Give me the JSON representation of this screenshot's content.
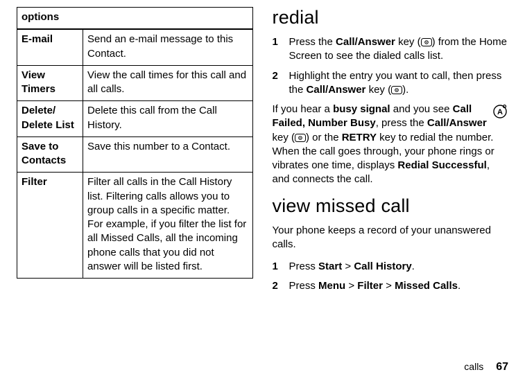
{
  "table": {
    "header": "options",
    "rows": [
      {
        "name": "E-mail",
        "desc": "Send an e-mail message to this Contact."
      },
      {
        "name": "View Timers",
        "desc": "View the call times for this call and all calls."
      },
      {
        "name": "Delete/\nDelete List",
        "desc": "Delete this call from the Call History."
      },
      {
        "name": "Save to Contacts",
        "desc": "Save this number to a Contact."
      },
      {
        "name": "Filter",
        "desc": "Filter all calls in the Call History list. Filtering calls allows you to group calls in a specific matter. For example, if you filter the list for all Missed Calls, all the incoming phone calls that you did not answer will be listed first."
      }
    ]
  },
  "redial": {
    "heading": "redial",
    "step1_num": "1",
    "step1_pre": "Press the ",
    "step1_key": "Call/Answer",
    "step1_mid": " key (",
    "step1_post": ") from the Home Screen to see the dialed calls list.",
    "step2_num": "2",
    "step2_pre": "Highlight the entry you want to call, then press the ",
    "step2_key": "Call/Answer",
    "step2_mid": " key (",
    "step2_post": ").",
    "busy_pre": "If you hear a ",
    "busy_strong": "busy signal",
    "busy_mid1": " and you see ",
    "busy_callfailed": "Call Failed, Number Busy",
    "busy_mid2": ", press the ",
    "busy_key": "Call/Answer",
    "busy_mid3": " key (",
    "busy_mid4": ") or the ",
    "busy_retry": "RETRY",
    "busy_mid5": " key to redial the number. When the call goes through, your phone rings or vibrates one time, displays ",
    "busy_success": "Redial Successful",
    "busy_post": ", and connects the call."
  },
  "missed": {
    "heading": "view missed call",
    "intro": "Your phone keeps a record of your unanswered calls.",
    "step1_num": "1",
    "step1_pre": "Press ",
    "step1_start": "Start",
    "step1_gt": " > ",
    "step1_ch": "Call History",
    "step1_post": ".",
    "step2_num": "2",
    "step2_pre": "Press ",
    "step2_menu": "Menu",
    "step2_gt1": " > ",
    "step2_filter": "Filter",
    "step2_gt2": " > ",
    "step2_mc": "Missed Calls",
    "step2_post": "."
  },
  "footer": {
    "label": "calls",
    "page": "67"
  }
}
